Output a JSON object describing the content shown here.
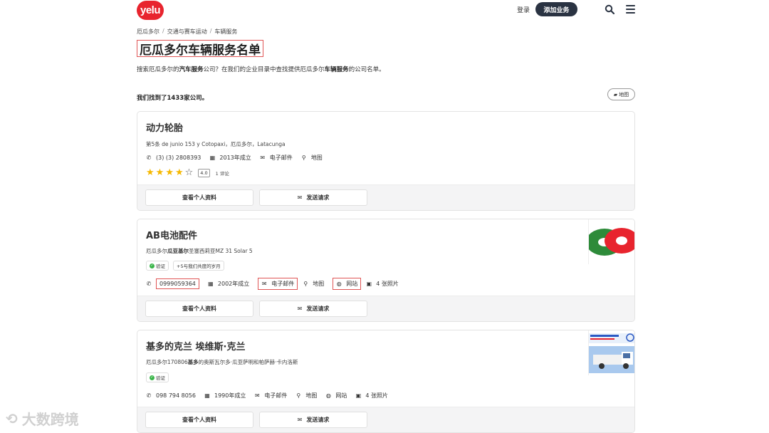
{
  "header": {
    "logo_text": "yelu",
    "login_label": "登录",
    "add_business_label": "添加业务"
  },
  "breadcrumb": [
    "厄瓜多尔",
    "交通与赛车运动",
    "车辆服务"
  ],
  "page_title": "厄瓜多尔车辆服务名单",
  "intro": {
    "part1": "搜索厄瓜多尔的",
    "bold1": "汽车服务",
    "part2": "公司？在我们的企业目录中查找提供厄瓜多尔",
    "bold2": "车辆服务",
    "part3": "的公司名单。"
  },
  "found_text": "我们找到了1433家公司。",
  "map_button_label": "地图",
  "listings": [
    {
      "name": "动力轮胎",
      "address": "第5条 de junio 153 y Cotopaxi，厄瓜多尔，Latacunga",
      "phone": "(3) (3) 2808393",
      "founded": "2013年成立",
      "email": "电子邮件",
      "map": "地图",
      "rating": 4,
      "rating_text": "4.0",
      "reviews": "1 评论",
      "profile_label": "查看个人资料",
      "request_label": "发送请求"
    },
    {
      "name": "AB电池配件",
      "address_prefix": "厄瓜多尔",
      "address_bold": "瓜亚基尔",
      "address_rest": "圣塞西莉亚MZ 31 Solar 5",
      "verified": "验证",
      "years": "+5与我们共度的岁月",
      "phone": "0999059364",
      "founded": "2002年成立",
      "email": "电子邮件",
      "map": "地图",
      "website": "网站",
      "photos": "4 张照片",
      "profile_label": "查看个人资料",
      "request_label": "发送请求"
    },
    {
      "name": "基多的克兰 埃维斯·克兰",
      "address_prefix": "厄瓜多尔170806",
      "address_bold": "基多",
      "address_rest": "的奥斯瓦尔多·瓜亚萨明和帕萨赫·卡内洛斯",
      "verified": "验证",
      "phone": "098 794 8056",
      "founded": "1990年成立",
      "email": "电子邮件",
      "map": "地图",
      "website": "网站",
      "photos": "4 张照片",
      "profile_label": "查看个人资料",
      "request_label": "发送请求"
    }
  ],
  "watermark": "大数跨境",
  "colors": {
    "brand": "#e8242e",
    "dark_button": "#2a3342",
    "star": "#f5b800",
    "verified": "#3bb54a"
  }
}
